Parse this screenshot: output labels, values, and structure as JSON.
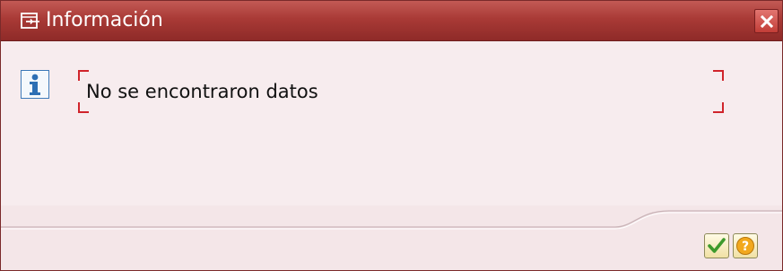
{
  "dialog": {
    "title": "Información",
    "message": "No se encontraron datos"
  },
  "icons": {
    "title": "window-icon",
    "message": "info-icon",
    "close": "close-icon",
    "confirm": "checkmark-icon",
    "help": "question-icon"
  },
  "colors": {
    "titlebar": "#a93a36",
    "background": "#f7ecee",
    "frame_corners": "#d0242b"
  }
}
